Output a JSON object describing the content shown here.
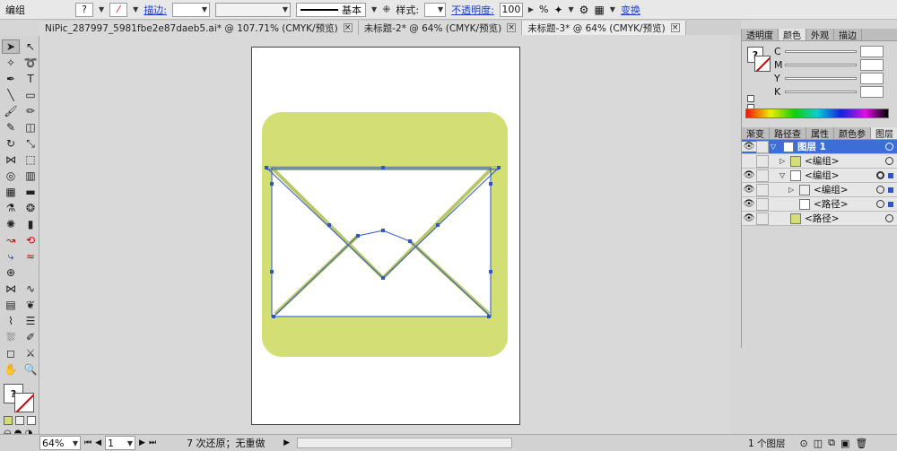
{
  "control": {
    "mode": "编组",
    "stroke_label": "描边:",
    "stroke_style": "基本",
    "style_label": "样式:",
    "opacity_label": "不透明度:",
    "opacity_value": "100",
    "opacity_unit": "%",
    "transform_label": "变换"
  },
  "tabs": [
    {
      "label": "NiPic_287997_5981fbe2e87daeb5.ai* @ 107.71% (CMYK/预览)"
    },
    {
      "label": "未标题-2* @ 64% (CMYK/预览)"
    },
    {
      "label": "未标题-3* @ 64% (CMYK/预览)"
    }
  ],
  "color_panel": {
    "tabs": [
      "透明度",
      "颜色",
      "外观",
      "描边"
    ],
    "channels": [
      "C",
      "M",
      "Y",
      "K"
    ]
  },
  "layers_panel": {
    "tabs": [
      "渐变",
      "路径查",
      "属性",
      "颜色参",
      "图层"
    ],
    "rows": [
      {
        "label": "图层 1"
      },
      {
        "label": "<编组>"
      },
      {
        "label": "<编组>"
      },
      {
        "label": "<编组>"
      },
      {
        "label": "<路径>"
      },
      {
        "label": "<路径>"
      }
    ],
    "footer": "1 个图层"
  },
  "status": {
    "zoom": "64%",
    "page": "1",
    "message": "7 次还原；无重做"
  },
  "colors": {
    "artwork_green": "#d3de75",
    "selection_blue": "#2e56c6"
  }
}
